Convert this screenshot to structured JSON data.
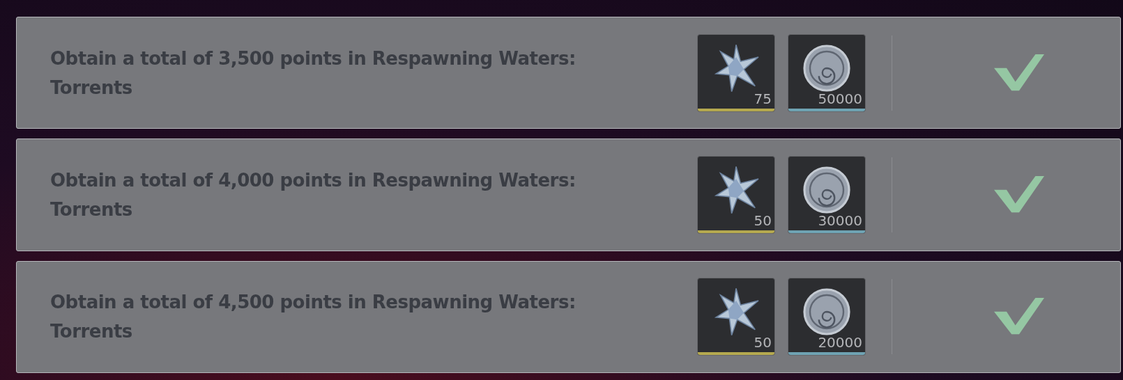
{
  "quests": [
    {
      "text": "Obtain a total of 3,500 points in Respawning Waters: Torrents",
      "completed": true,
      "rewards": [
        {
          "kind": "star",
          "count": "75",
          "color": "#b5a94f"
        },
        {
          "kind": "coin",
          "count": "50000",
          "color": "#6fa3b3"
        }
      ]
    },
    {
      "text": "Obtain a total of 4,000 points in Respawning Waters: Torrents",
      "completed": true,
      "rewards": [
        {
          "kind": "star",
          "count": "50",
          "color": "#b5a94f"
        },
        {
          "kind": "coin",
          "count": "30000",
          "color": "#6fa3b3"
        }
      ]
    },
    {
      "text": "Obtain a total of 4,500 points in Respawning Waters: Torrents",
      "completed": true,
      "rewards": [
        {
          "kind": "star",
          "count": "50",
          "color": "#b5a94f"
        },
        {
          "kind": "coin",
          "count": "20000",
          "color": "#6fa3b3"
        }
      ]
    }
  ]
}
